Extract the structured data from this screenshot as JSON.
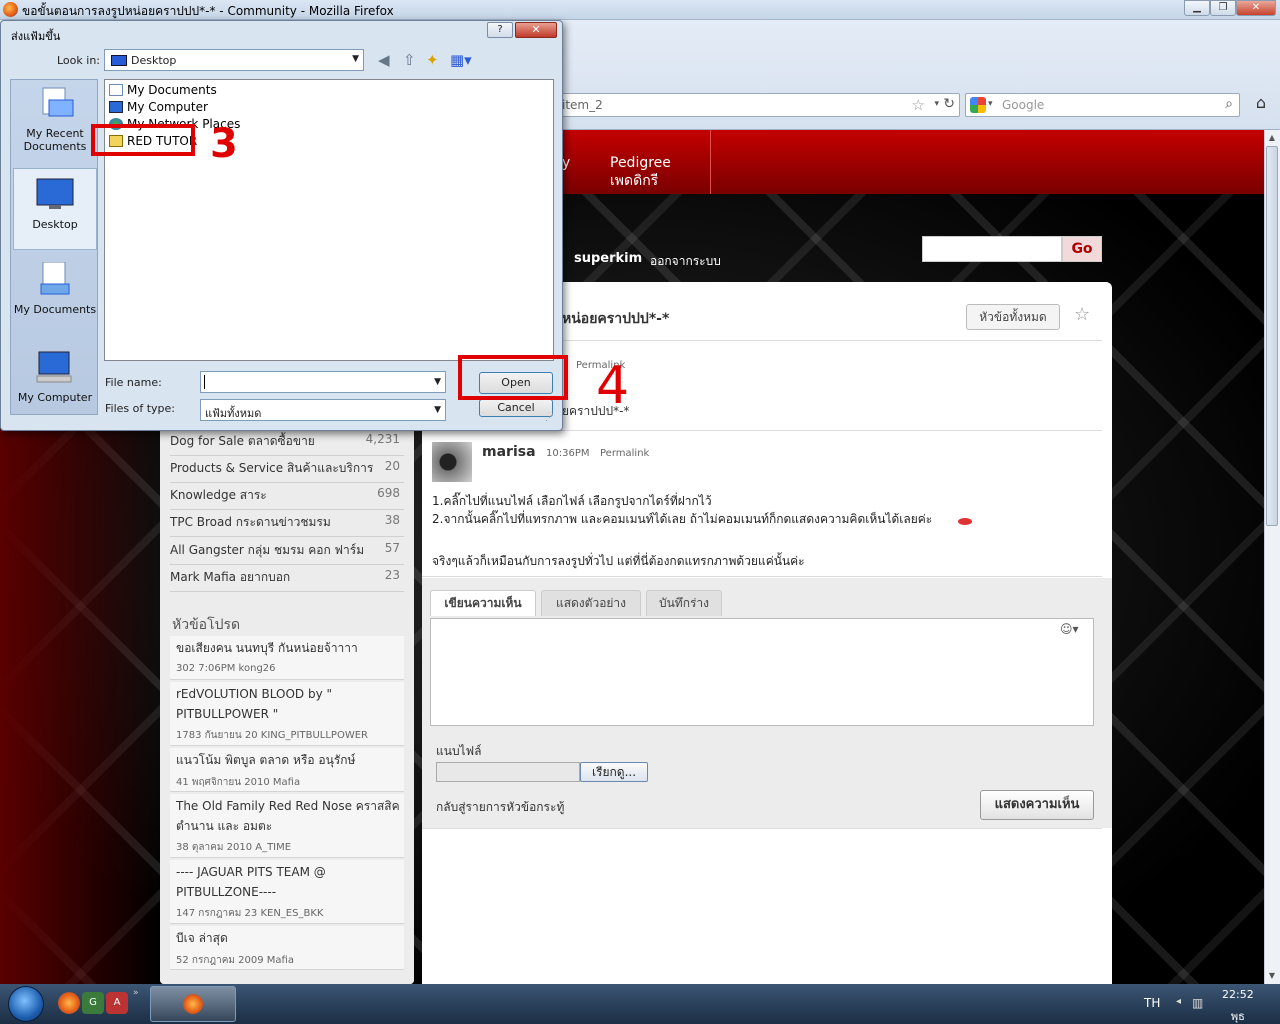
{
  "window": {
    "title": "ขอขั้นตอนการลงรูปหน่อยคราปปป*-* - Community - Mozilla Firefox"
  },
  "browser": {
    "url_fragment": "item_2",
    "search_placeholder": "Google"
  },
  "site": {
    "nav": [
      {
        "line1": "y",
        "line2": ""
      },
      {
        "line1": "Pedigree",
        "line2": "เพดดิกรี"
      }
    ],
    "username": "superkim",
    "logout": "ออกจากระบบ",
    "search_button": "Go"
  },
  "sidebar": {
    "categories": [
      {
        "label": "Dog for Sale ตลาดซื้อขาย",
        "count": "4,231"
      },
      {
        "label": "Products & Service สินค้าและบริการ",
        "count": "20"
      },
      {
        "label": "Knowledge สาระ",
        "count": "698"
      },
      {
        "label": "TPC Broad กระดานข่าวชมรม",
        "count": "38"
      },
      {
        "label": "All Gangster กลุ่ม ชมรม คอก ฟาร์ม",
        "count": "57"
      },
      {
        "label": "Mark Mafia อยากบอก",
        "count": "23"
      }
    ],
    "favorites_heading": "หัวข้อโปรด",
    "favorites": [
      {
        "title": "ขอเสียงคน นนทบุรี กันหน่อยจ้าาาา",
        "meta": "302  7:06PM   kong26"
      },
      {
        "title": "rEdVOLUTION BLOOD by \" PITBULLPOWER \"",
        "meta": "1783  กันยายน 20   KING_PITBULLPOWER"
      },
      {
        "title": "แนวโน้ม พิตบูล ตลาด หรือ อนุรักษ์",
        "meta": "41  พฤศจิกายน 2010   Mafia"
      },
      {
        "title": "The Old Family Red Red Nose คราสสิค ตำนาน และ อมตะ",
        "meta": "38  ตุลาคม 2010   A_TIME"
      },
      {
        "title": "---- JAGUAR PITS TEAM @ PITBULLZONE----",
        "meta": "147  กรกฎาคม 23   KEN_ES_BKK"
      },
      {
        "title": "บีเจ ล่าสุด",
        "meta": "52  กรกฎาคม 2009   Mafia"
      }
    ]
  },
  "thread": {
    "title_visible": "หน่อยคราปปป*-*",
    "all_topics_button": "หัวข้อทั้งหมด",
    "op_permalink": "Permalink",
    "op_snippet": "ยคราปปป*-*",
    "reply": {
      "author": "marisa",
      "time": "10:36PM",
      "permalink": "Permalink",
      "lines": [
        "1.คลิ๊กไปที่แนบไฟล์ เลือกไฟล์ เลือกรูปจากไดร์ที่ฝากไว้",
        "2.จากนั้นคลิ๊กไปที่แทรกภาพ และคอมเมนท์ได้เลย ถ้าไม่คอมเมนท์ก็กดแสดงความคิดเห็นได้เลยค่ะ",
        "จริงๆแล้วก็เหมือนกับการลงรูปทั่วไป แต่ที่นี่ต้องกดแทรกภาพด้วยแค่นั้นค่ะ"
      ]
    }
  },
  "editor": {
    "tabs": [
      "เขียนความเห็น",
      "แสดงตัวอย่าง",
      "บันทึกร่าง"
    ],
    "smiley": "☺▾",
    "attach_label": "แนบไฟล์",
    "browse_button": "เรียกดู...",
    "back_link": "กลับสู่รายการหัวข้อกระทู้",
    "post_button": "แสดงความเห็น"
  },
  "dialog": {
    "title": "ส่งแฟ้มขึ้น",
    "help": "?",
    "close": "✕",
    "look_in_label": "Look in:",
    "look_in_value": "Desktop",
    "places": [
      "My Recent Documents",
      "Desktop",
      "My Documents",
      "My Computer"
    ],
    "files": [
      "My Documents",
      "My Computer",
      "My Network Places",
      "RED TUTOR"
    ],
    "file_name_label": "File name:",
    "file_name_value": "",
    "file_type_label": "Files of type:",
    "file_type_value": "แฟ้มทั้งหมด",
    "open_button": "Open",
    "cancel_button": "Cancel"
  },
  "annotations": {
    "step3": "3",
    "step4": "4"
  },
  "taskbar": {
    "language": "TH",
    "time": "22:52",
    "day": "พุธ"
  },
  "colors": {
    "site_red": "#c40000",
    "annotation_red": "#e00000",
    "link_gray": "#666666"
  }
}
